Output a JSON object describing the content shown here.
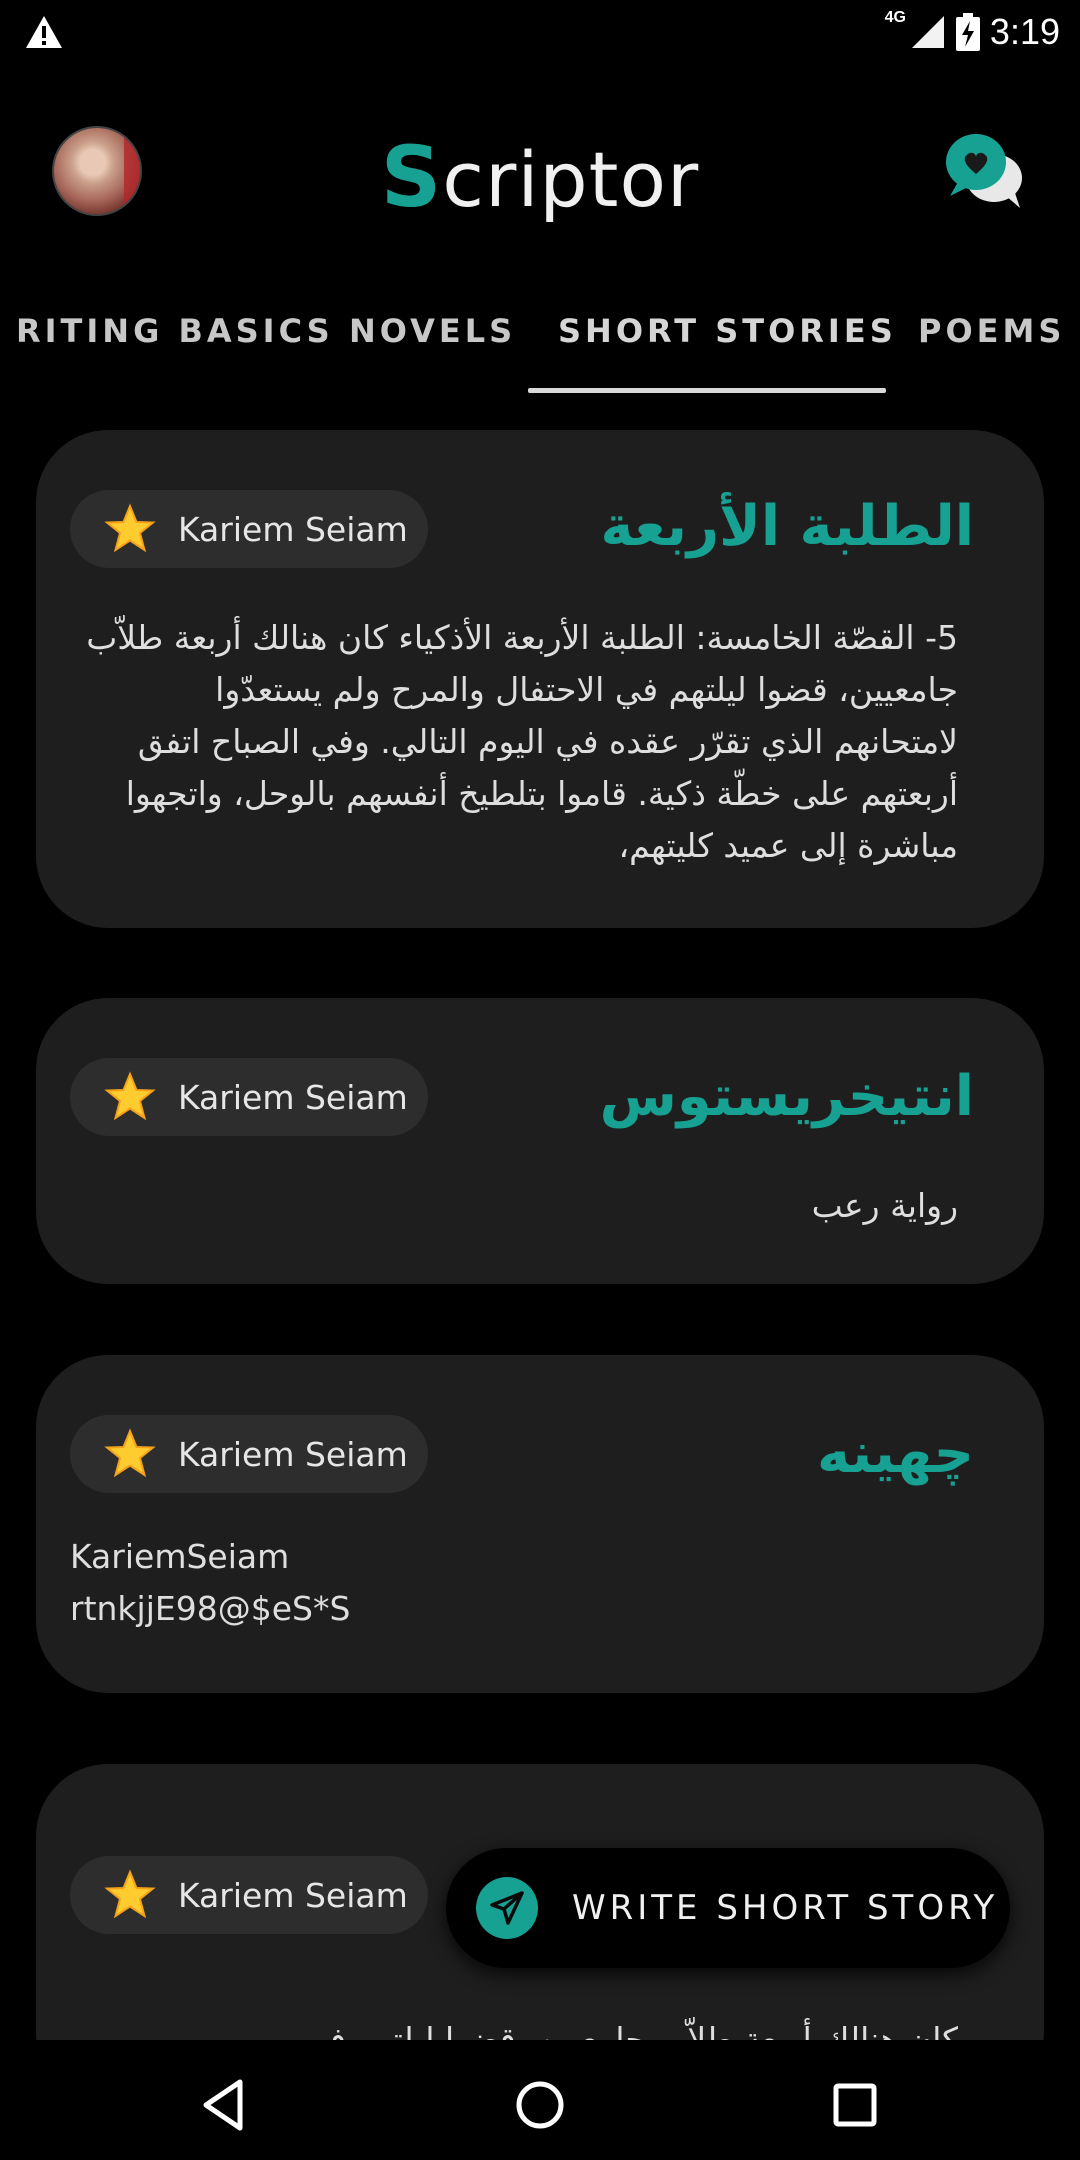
{
  "status_bar": {
    "network": "4G",
    "time": "3:19",
    "icons": [
      "warning-icon",
      "signal-icon",
      "battery-charging-icon"
    ]
  },
  "app_bar": {
    "title_first_letter": "S",
    "title_rest": "criptor",
    "avatar": "profile-avatar",
    "chat_icon": "chat-heart-icon"
  },
  "tabs": [
    {
      "label": "WRITING BASICS",
      "visible": "RITING BASICS"
    },
    {
      "label": "NOVELS"
    },
    {
      "label": "SHORT STORIES",
      "active": true
    },
    {
      "label": "POEMS"
    }
  ],
  "cards": [
    {
      "author": "Kariem Seiam",
      "title": "الطلبة الأربعة",
      "body": "5- القصّة الخامسة: الطلبة الأربعة الأذكياء كان هنالك أربعة طلاّب جامعيين، قضوا ليلتهم في الاحتفال والمرح ولم يستعدّوا لامتحانهم الذي تقرّر عقده في اليوم التالي. وفي الصباح اتفق أربعتهم على خطّة ذكية. قاموا بتلطيخ أنفسهم بالوحل، واتجهوا مباشرة إلى عميد كليتهم،"
    },
    {
      "author": "Kariem Seiam",
      "title": "انتيخريستوس",
      "body": "رواية رعب"
    },
    {
      "author": "Kariem Seiam",
      "title": "چهينه",
      "body": "KariemSeiam\nrtnkjjE98@$eS*S"
    },
    {
      "author": "Kariem Seiam",
      "title": "",
      "body": "كان هنالك أربعة طلاّب جامعيين، قضوا ليلتهم في"
    }
  ],
  "fab": {
    "label": "WRITE SHORT STORY",
    "icon": "send-icon"
  },
  "colors": {
    "accent": "#17a193",
    "card_bg": "#1e1e1e",
    "chip_bg": "#2d2d2d",
    "background": "#000000"
  }
}
